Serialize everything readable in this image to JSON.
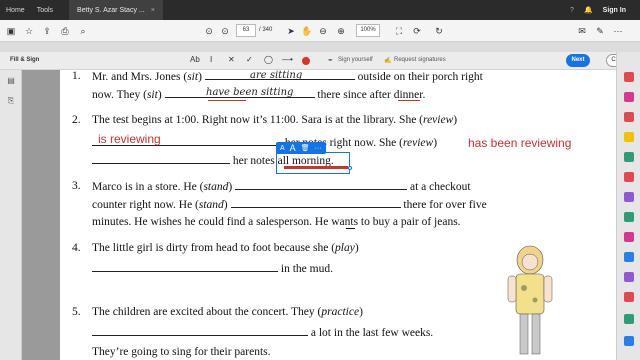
{
  "menu": {
    "home": "Home",
    "tools": "Tools",
    "tab_title": "Betty S. Azar Stacy ...",
    "tab_close": "×",
    "sign_in": "Sign In"
  },
  "toolbar": {
    "page_number": "63",
    "page_total": "/ 340",
    "zoom": "100%"
  },
  "fill_sign": {
    "title": "Fill & Sign",
    "sign_yourself": "Sign yourself",
    "request_signatures": "Request signatures",
    "next": "Next",
    "close": "Close"
  },
  "document": {
    "item1": {
      "num": "1.",
      "line1_a": "Mr. and Mrs. Jones (",
      "line1_verb": "sit",
      "line1_b": ")",
      "line1_c": "outside on their porch right",
      "hand1": "are sitting",
      "line2_a": "now.  They (",
      "line2_verb": "sit",
      "line2_b": ")",
      "hand2": "have been sitting",
      "line2_c": "there since after dinner."
    },
    "item2": {
      "num": "2.",
      "line1": "The test begins at 1:00.  Right now it’s 11:00.  Sara is at the library.  She (",
      "line1_verb": "review",
      "line1_end": ")",
      "red1": "is reviewing",
      "line2_mid": "her notes right now.  She (",
      "line2_verb": "review",
      "line2_end": ")",
      "red2": "has been reviewing",
      "line3": "her notes all morning."
    },
    "item3": {
      "num": "3.",
      "line1_a": "Marco is in a store.  He (",
      "line1_verb": "stand",
      "line1_b": ")",
      "line1_c": "at a checkout",
      "line2_a": "counter right now.  He (",
      "line2_verb": "stand",
      "line2_b": ")",
      "line2_c": "there for over five",
      "line3": "minutes.  He wishes he could find a salesperson.  He wants to buy a pair of jeans."
    },
    "item4": {
      "num": "4.",
      "line1_a": "The little girl is dirty from head to foot because she (",
      "line1_verb": "play",
      "line1_b": ")",
      "line2": "in the mud."
    },
    "item5": {
      "num": "5.",
      "line1_a": "The children are excited about the concert.  They (",
      "line1_verb": "practice",
      "line1_b": ")",
      "line2": "a lot in the last few weeks.",
      "line3": "They’re going to sing for their parents."
    }
  },
  "popup": {
    "text_small": "A",
    "text_large": "A",
    "more": "···"
  },
  "colors": {
    "accent": "#1473e6",
    "annotation_red": "#d0312d"
  }
}
